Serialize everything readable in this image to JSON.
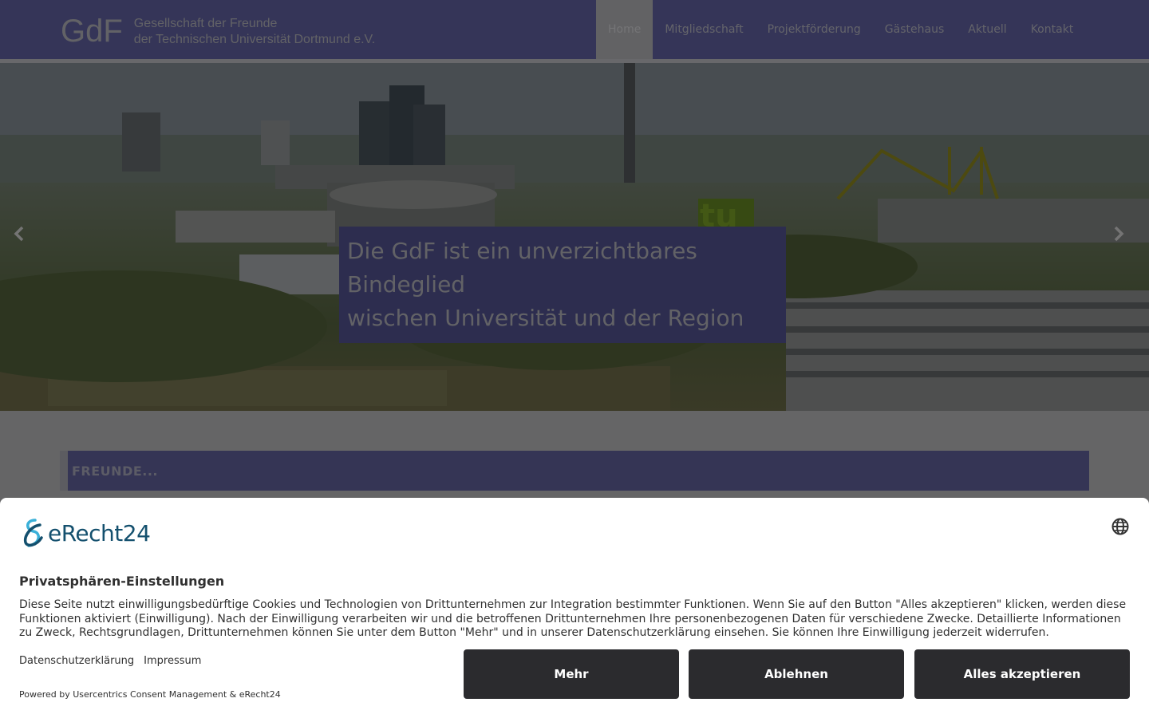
{
  "header": {
    "logo_mark": "GdF",
    "logo_line1": "Gesellschaft der Freunde",
    "logo_line2": "der Technischen Universität Dortmund e.V.",
    "nav": [
      "Home",
      "Mitgliedschaft",
      "Projektförderung",
      "Gästehaus",
      "Aktuell",
      "Kontakt"
    ],
    "active_nav": "Home"
  },
  "hero": {
    "caption_line1": "Die GdF ist ein unverzichtbares",
    "caption_line2": "Bindeglied",
    "caption_line3": "wischen Universität und der Region",
    "sign_text": "tu",
    "prev_icon": "chevron-left-icon",
    "next_icon": "chevron-right-icon"
  },
  "content": {
    "section_title": "FREUNDE..."
  },
  "consent": {
    "brand": "eRecht24",
    "title": "Privatsphären-Einstellungen",
    "text": "Diese Seite nutzt einwilligungsbedürftige Cookies und Technologien von Drittunternehmen zur Integration bestimmter Funktionen. Wenn Sie auf den Button \"Alles akzeptieren\" klicken, werden diese Funktionen aktiviert (Einwilligung). Nach der Einwilligung verarbeiten wir und die betroffenen Drittunternehmen Ihre personenbezogenen Daten für verschiedene Zwecke. Detaillierte Informationen zu Zweck, Rechtsgrundlagen, Drittunternehmen können Sie unter dem Button \"Mehr\" und in unserer Datenschutzerklärung einsehen. Sie können Ihre Einwilligung jederzeit widerrufen.",
    "link_privacy": "Datenschutzerklärung",
    "link_imprint": "Impressum",
    "powered": "Powered by Usercentrics Consent Management & eRecht24",
    "btn_more": "Mehr",
    "btn_deny": "Ablehnen",
    "btn_accept": "Alles akzeptieren",
    "language_icon": "globe-icon",
    "button_color": "#2b2b2e",
    "brand_color": "#14506e"
  },
  "colors": {
    "header_bg": "#6a6ab0",
    "caption_bg": "#5a5a9e"
  }
}
